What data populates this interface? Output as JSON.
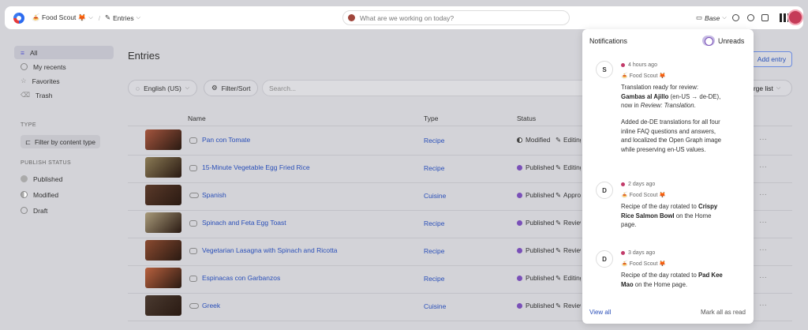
{
  "topbar": {
    "workspace": "🍝 Food Scout 🦊",
    "section": "Entries",
    "search_placeholder": "What are we working on today?",
    "branch": "Base"
  },
  "sidebar": {
    "items": [
      {
        "label": "All",
        "icon": "list-icon"
      },
      {
        "label": "My recents",
        "icon": "clock-icon"
      },
      {
        "label": "Favorites",
        "icon": "star-icon"
      },
      {
        "label": "Trash",
        "icon": "trash-icon"
      }
    ],
    "type_heading": "TYPE",
    "filter_button": "Filter by content type",
    "status_heading": "PUBLISH STATUS",
    "statuses": [
      "Published",
      "Modified",
      "Draft"
    ]
  },
  "main": {
    "title": "Entries",
    "add_entry": "Add entry",
    "locale": "English (US)",
    "filter_sort": "Filter/Sort",
    "search_placeholder": "Search...",
    "view": "rge list",
    "columns": {
      "name": "Name",
      "type": "Type",
      "status": "Status"
    },
    "rows": [
      {
        "title": "Pan con Tomate",
        "type": "Recipe",
        "status": "Modified",
        "workflow": "Editing",
        "color": "#a4553e"
      },
      {
        "title": "15-Minute Vegetable Egg Fried Rice",
        "type": "Recipe",
        "status": "Published",
        "workflow": "Editing",
        "color": "#8a7a55"
      },
      {
        "title": "Spanish",
        "type": "Cuisine",
        "status": "Published",
        "workflow": "Approved",
        "color": "#5a3a2a"
      },
      {
        "title": "Spinach and Feta Egg Toast",
        "type": "Recipe",
        "status": "Published",
        "workflow": "Review",
        "color": "#a89a7a"
      },
      {
        "title": "Vegetarian Lasagna with Spinach and Ricotta",
        "type": "Recipe",
        "status": "Published",
        "workflow": "Review",
        "color": "#8a4a30"
      },
      {
        "title": "Espinacas con Garbanzos",
        "type": "Recipe",
        "status": "Published",
        "workflow": "Editing",
        "color": "#b8603e"
      },
      {
        "title": "Greek",
        "type": "Cuisine",
        "status": "Published",
        "workflow": "Review",
        "color": "#4a3a30"
      }
    ]
  },
  "notifications": {
    "title": "Notifications",
    "unreads_label": "Unreads",
    "items": [
      {
        "avatar": "S",
        "time": "4 hours ago",
        "workspace": "🍝 Food Scout 🦊",
        "p1_a": "Translation ready for review: ",
        "p1_b": "Gambas al Ajillo",
        "p1_c": " (en-US → de-DE), now in ",
        "p1_d": "Review: Translation",
        "p1_e": ".",
        "p2": "Added de-DE translations for all four inline FAQ questions and answers, and localized the Open Graph image while preserving en-US values."
      },
      {
        "avatar": "D",
        "time": "2 days ago",
        "workspace": "🍝 Food Scout 🦊",
        "p1_a": "Recipe of the day rotated to ",
        "p1_b": "Crispy Rice Salmon Bowl",
        "p1_c": " on the Home page."
      },
      {
        "avatar": "D",
        "time": "3 days ago",
        "workspace": "🍝 Food Scout 🦊",
        "p1_a": "Recipe of the day rotated to ",
        "p1_b": "Pad Kee Mao",
        "p1_c": " on the Home page."
      }
    ],
    "view_all": "View all",
    "mark_all": "Mark all as read"
  }
}
